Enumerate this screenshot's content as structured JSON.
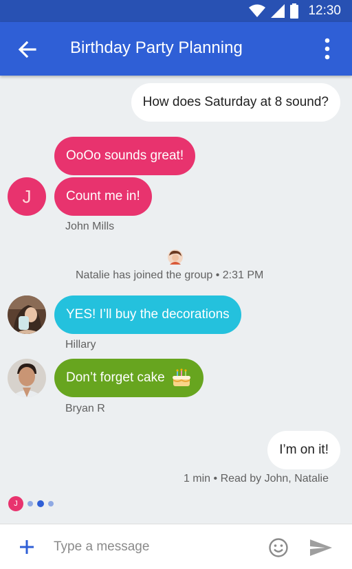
{
  "status_bar": {
    "time": "12:30"
  },
  "app_bar": {
    "title": "Birthday Party Planning"
  },
  "messages": {
    "outgoing_1": "How does Saturday at 8 sound?",
    "john_1": "OoOo sounds great!",
    "john_2": "Count me in!",
    "john_avatar_letter": "J",
    "john_name": "John Mills",
    "system_event": "Natalie has joined the group • 2:31 PM",
    "hillary_msg": "YES! I’ll buy the decorations",
    "hillary_name": "Hillary",
    "bryan_msg": "Don’t forget cake",
    "bryan_name": "Bryan R",
    "outgoing_2": "I’m on it!",
    "read_receipt": "1 min • Read by John, Natalie"
  },
  "typing_indicator": {
    "avatar_letter": "J"
  },
  "composer": {
    "placeholder": "Type a message"
  },
  "colors": {
    "status_bar": "#2851b3",
    "app_bar": "#2f5fd6",
    "john": "#e8336e",
    "hillary": "#24c1dd",
    "bryan": "#67a51f",
    "background": "#eceff1"
  },
  "icons": {
    "wifi": "wifi-icon",
    "signal": "signal-icon",
    "battery": "battery-icon",
    "back": "arrow-back-icon",
    "more": "more-vert-icon",
    "add": "plus-icon",
    "emoji": "emoji-icon",
    "send": "send-icon",
    "cake": "cake-icon"
  }
}
